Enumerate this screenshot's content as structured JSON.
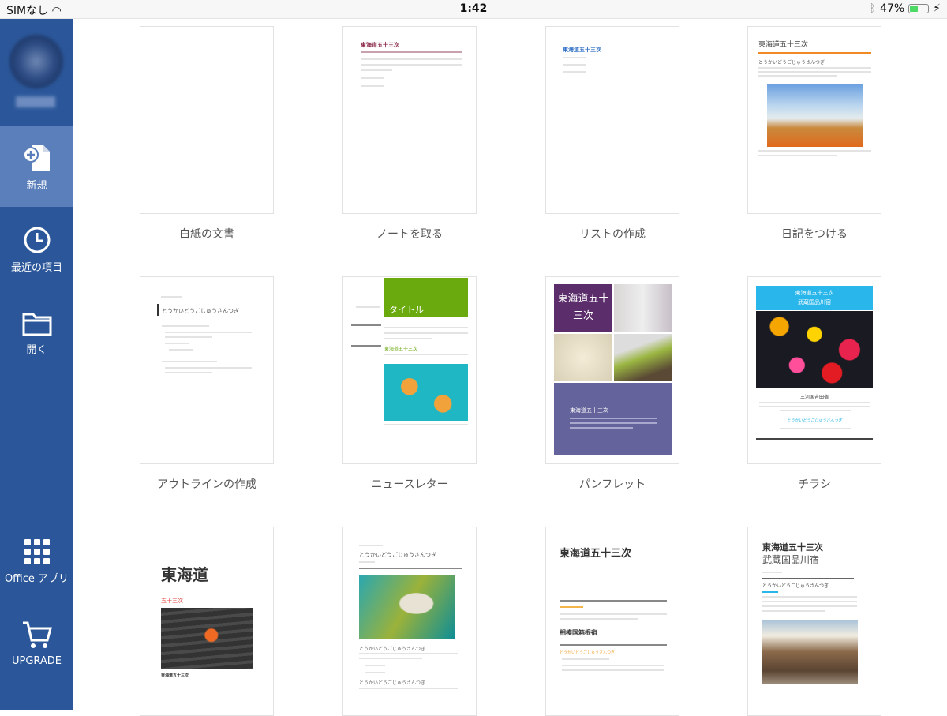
{
  "status": {
    "carrier": "SIMなし",
    "time": "1:42",
    "battery": "47%",
    "battery_level": 0.47
  },
  "sidebar": {
    "items": [
      {
        "label": "新規"
      },
      {
        "label": "最近の項目"
      },
      {
        "label": "開く"
      },
      {
        "label": "Office アプリ"
      },
      {
        "label": "UPGRADE"
      }
    ]
  },
  "templates": [
    {
      "label": "白紙の文書"
    },
    {
      "label": "ノートを取る",
      "title": "東海道五十三次"
    },
    {
      "label": "リストの作成",
      "title": "東海道五十三次"
    },
    {
      "label": "日記をつける",
      "title": "東海道五十三次",
      "subtitle": "とうかいどうごじゅうさんつぎ"
    },
    {
      "label": "アウトラインの作成",
      "title": "とうかいどうごじゅうさんつぎ"
    },
    {
      "label": "ニュースレター",
      "title": "タイトル",
      "heading": "東海道五十三次"
    },
    {
      "label": "パンフレット",
      "title": "東海道五十三次",
      "heading": "東海道五十三次"
    },
    {
      "label": "チラシ",
      "title": "東海道五十三次",
      "title2": "武蔵国品川宿",
      "heading": "三河国吉田宿",
      "tagline": "とうかいどうごじゅうさんつぎ"
    },
    {
      "label": "",
      "title": "東海道",
      "subtitle": "五十三次",
      "caption": "東海道五十三次"
    },
    {
      "label": "",
      "title": "とうかいどうごじゅうさんつぎ",
      "heading": "とうかいどうごじゅうさんつぎ",
      "heading2": "とうかいどうごじゅうさんつぎ"
    },
    {
      "label": "",
      "title": "東海道五十三次",
      "heading": "相模国箱根宿",
      "tagline": "とうかいどうごじゅうさんつぎ"
    },
    {
      "label": "",
      "title": "東海道五十三次",
      "title2": "武蔵国品川宿",
      "heading": "とうかいどうごじゅうさんつぎ"
    }
  ]
}
